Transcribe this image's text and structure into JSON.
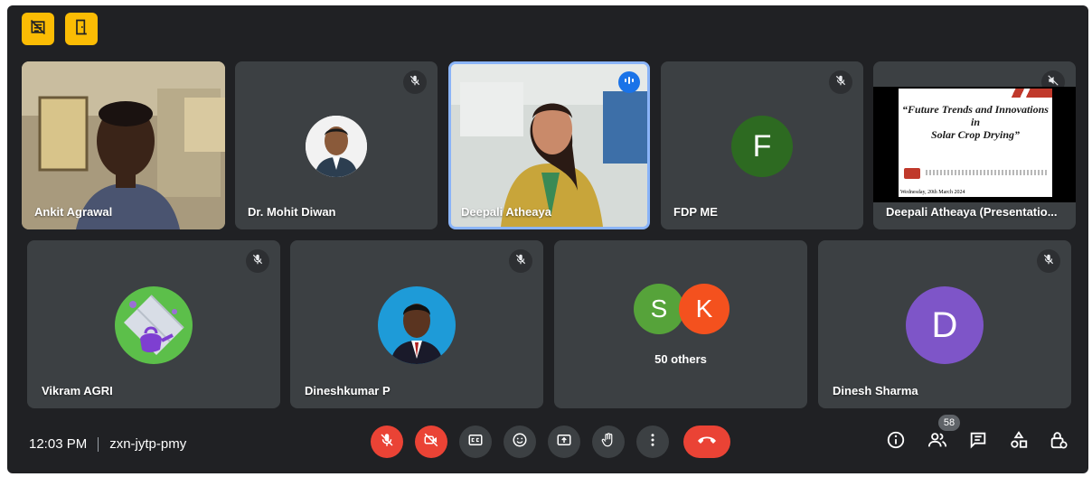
{
  "top_buttons": [
    {
      "icon": "layout-off-icon"
    },
    {
      "icon": "door-icon"
    }
  ],
  "tiles": [
    {
      "name": "Ankit Agrawal",
      "type": "video"
    },
    {
      "name": "Dr. Mohit Diwan",
      "type": "photo",
      "muted": true
    },
    {
      "name": "Deepali Atheaya",
      "type": "video",
      "speaking": true
    },
    {
      "name": "FDP ME",
      "type": "letter",
      "letter": "F",
      "color": "#2d6a21",
      "muted": true
    },
    {
      "name": "Deepali Atheaya (Presentatio...",
      "type": "presentation",
      "muted": true
    }
  ],
  "tiles_row2": [
    {
      "name": "Vikram AGRI",
      "type": "avatar",
      "muted": true
    },
    {
      "name": "Dineshkumar P",
      "type": "photo",
      "muted": true
    },
    {
      "name": "",
      "type": "group",
      "letters": [
        "S",
        "K"
      ],
      "colors": [
        "#56a33a",
        "#f4511e"
      ],
      "others_label": "50 others"
    },
    {
      "name": "Dinesh Sharma",
      "type": "letter",
      "letter": "D",
      "color": "#7e55c8",
      "muted": true
    }
  ],
  "presentation": {
    "line1": "“Future Trends and Innovations",
    "line2": "in",
    "line3": "Solar Crop Drying”",
    "footer": "Wednesday, 20th March 2024"
  },
  "bottom": {
    "time": "12:03 PM",
    "meeting_code": "zxn-jytp-pmy",
    "participants_count": "58"
  },
  "controls": [
    "mic-off-icon",
    "camera-off-icon",
    "captions-icon",
    "emoji-icon",
    "present-icon",
    "raise-hand-icon",
    "more-options-icon",
    "end-call-icon"
  ],
  "right_icons": [
    "info-icon",
    "people-icon",
    "chat-icon",
    "activities-icon",
    "host-controls-icon"
  ],
  "colors": {
    "accent": "#fbbc04",
    "danger": "#ea4335",
    "tile": "#3c4043",
    "bg": "#202124",
    "speaking": "#8ab4f8"
  }
}
